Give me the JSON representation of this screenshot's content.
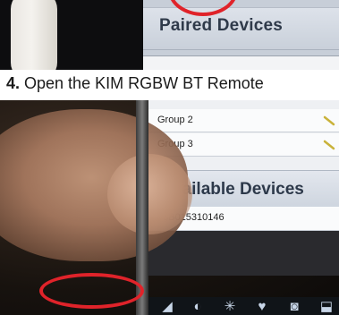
{
  "top": {
    "section_title": "Paired Devices"
  },
  "caption": {
    "step_number": "4.",
    "text": " Open the KIM RGBW  BT Remote"
  },
  "screen": {
    "groups": [
      {
        "label": "Group 2"
      },
      {
        "label": "Group 3"
      }
    ],
    "available_title": "Available Devices",
    "device_id": "08B015310146"
  },
  "icons": {
    "edit": "pencil-icon",
    "tabs": [
      "tab-icon-1",
      "tab-icon-2",
      "sun-icon",
      "heart-icon",
      "camera-icon",
      "tab-icon-6"
    ]
  },
  "colors": {
    "highlight_circle": "#e0232a"
  }
}
